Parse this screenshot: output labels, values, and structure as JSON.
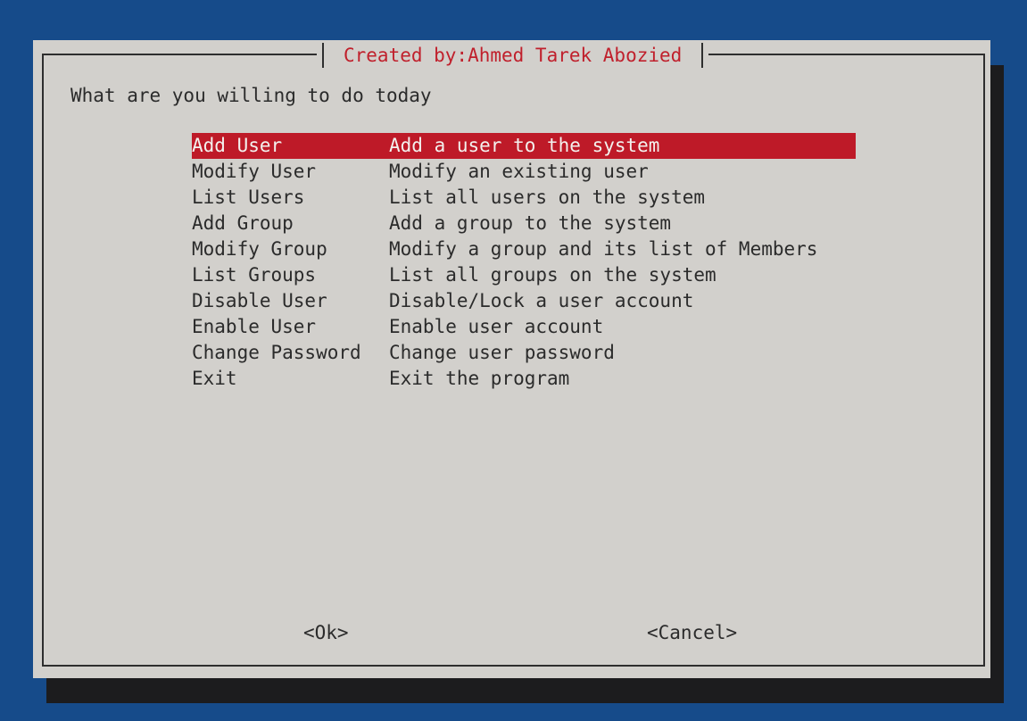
{
  "dialog": {
    "title": "Created by:Ahmed Tarek Abozied",
    "prompt": "What are you willing to do today"
  },
  "menu": {
    "selected_index": 0,
    "items": [
      {
        "tag": "Add User",
        "description": "Add a user to the system"
      },
      {
        "tag": "Modify User",
        "description": "Modify an existing user"
      },
      {
        "tag": "List Users",
        "description": "List all users on the system"
      },
      {
        "tag": "Add Group",
        "description": "Add a group to the system"
      },
      {
        "tag": "Modify Group",
        "description": "Modify a group and its list of Members"
      },
      {
        "tag": "List Groups",
        "description": "List all groups on the system"
      },
      {
        "tag": "Disable User",
        "description": "Disable/Lock a user account"
      },
      {
        "tag": "Enable User",
        "description": "Enable user account"
      },
      {
        "tag": "Change Password",
        "description": "Change user password"
      },
      {
        "tag": "Exit",
        "description": "Exit the program"
      }
    ]
  },
  "buttons": {
    "ok_label": "<Ok>",
    "cancel_label": "<Cancel>"
  },
  "colors": {
    "background": "#164b8a",
    "dialog": "#d2d0cc",
    "highlight": "#be1a28",
    "title": "#c0202c",
    "shadow": "#1c1c1e"
  }
}
